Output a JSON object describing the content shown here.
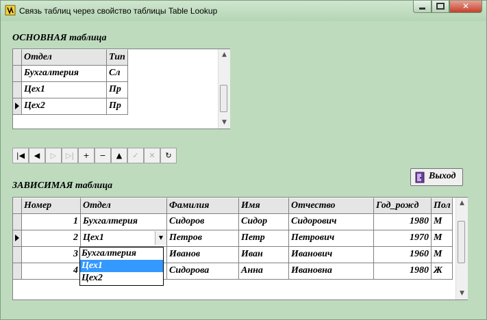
{
  "window": {
    "title": "Связь таблиц через свойство таблицы Table Lookup",
    "close_glyph": "✕"
  },
  "master": {
    "label": "ОСНОВНАЯ таблица",
    "columns": [
      "Отдел",
      "Тип"
    ],
    "rows": [
      [
        "Бухгалтерия",
        "Сл"
      ],
      [
        "Цех1",
        "Пр"
      ],
      [
        "Цех2",
        "Пр"
      ]
    ],
    "current_row": 2
  },
  "navigator": {
    "buttons": [
      {
        "name": "first-button",
        "glyph": "|◀",
        "enabled": true
      },
      {
        "name": "prior-button",
        "glyph": "◀",
        "enabled": true
      },
      {
        "name": "next-button",
        "glyph": "▷",
        "enabled": false
      },
      {
        "name": "last-button",
        "glyph": "▷|",
        "enabled": false
      },
      {
        "name": "insert-button",
        "glyph": "+",
        "enabled": true
      },
      {
        "name": "delete-button",
        "glyph": "−",
        "enabled": true
      },
      {
        "name": "edit-button",
        "glyph": "▲",
        "enabled": true
      },
      {
        "name": "post-button",
        "glyph": "✓",
        "enabled": false
      },
      {
        "name": "cancel-button",
        "glyph": "✕",
        "enabled": false
      },
      {
        "name": "refresh-button",
        "glyph": "↻",
        "enabled": true
      }
    ]
  },
  "exit_button": {
    "label": "Выход"
  },
  "detail": {
    "label": "ЗАВИСИМАЯ таблица",
    "columns": [
      "Номер",
      "Отдел",
      "Фамилия",
      "Имя",
      "Отчество",
      "Год_рожд",
      "Пол"
    ],
    "rows": [
      [
        "1",
        "Бухгалтерия",
        "Сидоров",
        "Сидор",
        "Сидорович",
        "1980",
        "М"
      ],
      [
        "2",
        "Цех1",
        "Петров",
        "Петр",
        "Петрович",
        "1970",
        "М"
      ],
      [
        "3",
        "",
        "Иванов",
        "Иван",
        "Иванович",
        "1960",
        "М"
      ],
      [
        "4",
        "",
        "Сидорова",
        "Анна",
        "Ивановна",
        "1980",
        "Ж"
      ]
    ],
    "current_row": 1,
    "dropdown_options": [
      "Бухгалтерия",
      "Цех1",
      "Цех2"
    ],
    "dropdown_selected": 1
  }
}
